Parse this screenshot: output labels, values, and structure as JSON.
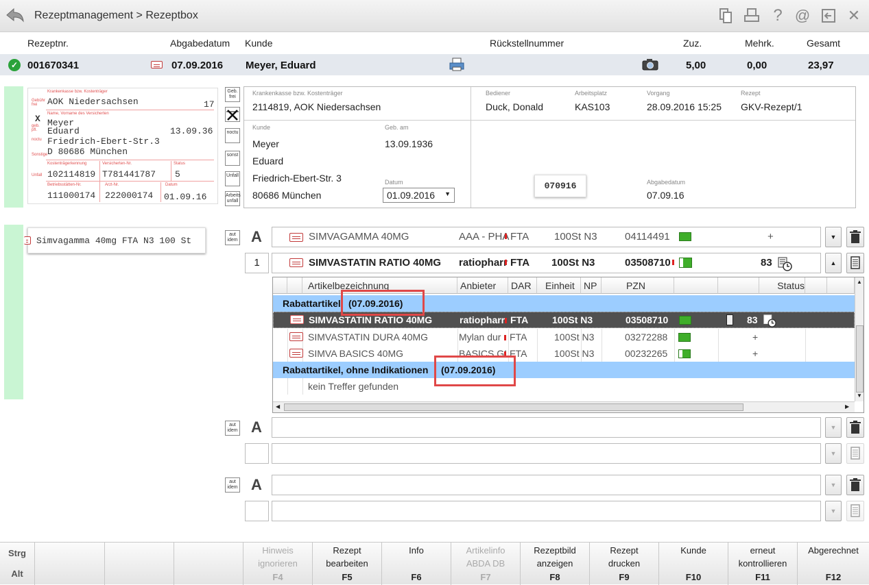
{
  "window": {
    "breadcrumb": "Rezeptmanagement > Rezeptbox",
    "toolbar_icons": [
      "copy-icon",
      "print-icon",
      "help-icon",
      "at-icon",
      "export-icon",
      "close-icon"
    ]
  },
  "header": {
    "labels": {
      "rezeptnr": "Rezeptnr.",
      "abgabedatum": "Abgabedatum",
      "kunde": "Kunde",
      "rueckstell": "Rückstellnummer",
      "zuz": "Zuz.",
      "mehrk": "Mehrk.",
      "gesamt": "Gesamt"
    },
    "values": {
      "rezeptnr": "001670341",
      "abgabedatum": "07.09.2016",
      "kunde": "Meyer, Eduard",
      "zuz": "5,00",
      "mehrk": "0,00",
      "gesamt": "23,97"
    }
  },
  "scan": {
    "labels": {
      "kasse": "Krankenkasse bzw. Kostenträger",
      "name": "Name, Vorname des Versicherten",
      "kk_kennung": "Kostenträgerkennung",
      "vers_nr": "Versicherten-Nr.",
      "status": "Status",
      "bs_nr": "Betriebsstätten-Nr.",
      "arzt_nr": "Arzt-Nr.",
      "datum": "Datum",
      "gebuehr": "Gebühr frei",
      "geb_pfl": "geb. pfl.",
      "noctu": "noctu",
      "sonstige": "Sonstige",
      "unfall": "Unfall"
    },
    "kasse": "AOK Niedersachsen",
    "kasse_suffix": "17",
    "mark": "X",
    "name1": "Meyer",
    "name2": "Eduard",
    "dob": "13.09.36",
    "street": "Friedrich-Ebert-Str.3",
    "city": "D 80686 München",
    "kk_nr": "102114819",
    "vers_nr": "T781441787",
    "status": "5",
    "bs_nr": "111000174",
    "arzt_nr": "222000174",
    "datum": "01.09.16",
    "item_text": "Simvagamma 40mg FTA N3 100 St"
  },
  "side_buttons": {
    "geb_frei": "Geb. frei",
    "noctu": "noctu",
    "sonst": "sonst",
    "unfall": "Unfall",
    "arbeitsunfall": "Arbeits unfall",
    "aut_idem": "aut idem"
  },
  "info": {
    "kasse_label": "Krankenkasse bzw. Kostenträger",
    "kasse_value": "2114819, AOK Niedersachsen",
    "bediener_label": "Bediener",
    "bediener_value": "Duck, Donald",
    "arbeitsplatz_label": "Arbeitsplatz",
    "arbeitsplatz_value": "KAS103",
    "vorgang_label": "Vorgang",
    "vorgang_value": "28.09.2016 15:25",
    "rezept_label": "Rezept",
    "rezept_value": "GKV-Rezept/1",
    "kunde_label": "Kunde",
    "kunde_line1": "Meyer",
    "kunde_line2": "Eduard",
    "kunde_line3": "Friedrich-Ebert-Str. 3",
    "kunde_line4": "80686 München",
    "geb_label": "Geb. am",
    "geb_value": "13.09.1936",
    "datum_label": "Datum",
    "datum_value": "01.09.2016",
    "stamp": "070916",
    "abgabe_label": "Abgabedatum",
    "abgabe_value": "07.09.16"
  },
  "items": {
    "a_label": "A",
    "row1": {
      "name": "SIMVAGAMMA 40MG",
      "anbieter": "AAA - PHA",
      "dar": "FTA",
      "einheit": "100St N3",
      "pzn": "04114491",
      "status": "+"
    },
    "row2_qty": "1",
    "row2": {
      "name": "SIMVASTATIN RATIO 40MG",
      "anbieter": "ratiopharr",
      "dar": "FTA",
      "einheit": "100St N3",
      "pzn": "03508710",
      "status": "83"
    }
  },
  "table": {
    "headers": {
      "artikel": "Artikelbezeichnung",
      "anbieter": "Anbieter",
      "dar": "DAR",
      "einheit": "Einheit",
      "np": "NP",
      "pzn": "PZN",
      "status": "Status"
    },
    "group1_title": "Rabattartikel",
    "group1_date": "(07.09.2016)",
    "rows": [
      {
        "name": "SIMVASTATIN RATIO 40MG",
        "anbieter": "ratiopharr",
        "dar": "FTA",
        "einheit": "100St N3",
        "pzn": "03508710",
        "status": "83"
      },
      {
        "name": "SIMVASTATIN DURA 40MG",
        "anbieter": "Mylan dur",
        "dar": "FTA",
        "einheit": "100St N3",
        "pzn": "03272288",
        "status": "+"
      },
      {
        "name": "SIMVA BASICS 40MG",
        "anbieter": "BASICS GI",
        "dar": "FTA",
        "einheit": "100St N3",
        "pzn": "00232265",
        "status": "+"
      }
    ],
    "group2_title": "Rabattartikel, ohne Indikationen",
    "group2_date": "(07.09.2016)",
    "empty_text": "kein Treffer gefunden"
  },
  "footer": {
    "modifiers": {
      "strg": "Strg",
      "alt": "Alt"
    },
    "keys": [
      {
        "l1": "Hinweis",
        "l2": "ignorieren",
        "k": "F4",
        "enabled": false
      },
      {
        "l1": "Rezept",
        "l2": "bearbeiten",
        "k": "F5",
        "enabled": true
      },
      {
        "l1": "Info",
        "l2": "",
        "k": "F6",
        "enabled": true
      },
      {
        "l1": "Artikelinfo",
        "l2": "ABDA DB",
        "k": "F7",
        "enabled": false
      },
      {
        "l1": "Rezeptbild",
        "l2": "anzeigen",
        "k": "F8",
        "enabled": true
      },
      {
        "l1": "Rezept",
        "l2": "drucken",
        "k": "F9",
        "enabled": true
      },
      {
        "l1": "Kunde",
        "l2": "",
        "k": "F10",
        "enabled": true
      },
      {
        "l1": "erneut",
        "l2": "kontrollieren",
        "k": "F11",
        "enabled": true
      },
      {
        "l1": "Abgerechnet",
        "l2": "",
        "k": "F12",
        "enabled": true
      }
    ]
  },
  "colors": {
    "selection_blue": "#9ccdff",
    "green_strip": "#c9f5d3",
    "highlight_red": "#e04848"
  }
}
